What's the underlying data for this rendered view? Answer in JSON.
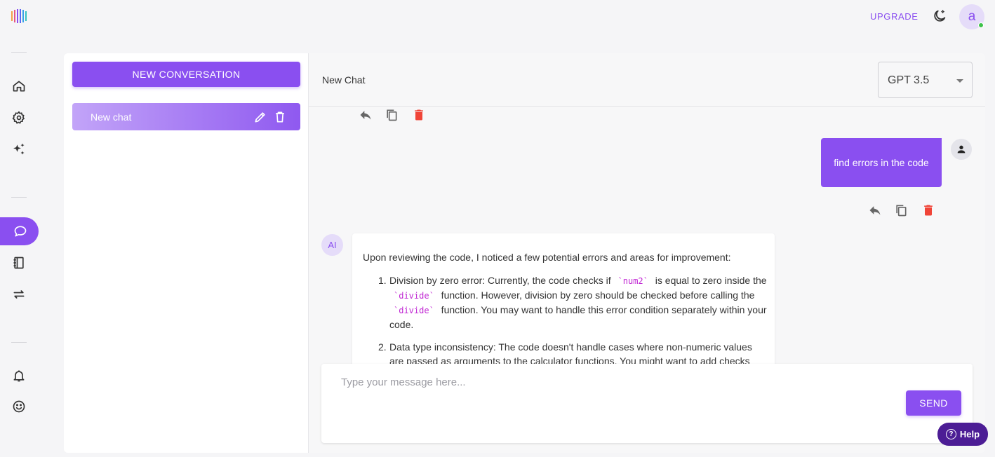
{
  "topbar": {
    "upgrade_label": "UPGRADE",
    "avatar_letter": "a"
  },
  "sidebar": {
    "items": [
      {
        "icon": "home-icon"
      },
      {
        "icon": "gear-icon"
      },
      {
        "icon": "sparkles-icon"
      },
      {
        "icon": "chat-bubble-icon",
        "active": true
      },
      {
        "icon": "notebook-icon"
      },
      {
        "icon": "swap-arrows-icon"
      },
      {
        "icon": "bell-icon"
      },
      {
        "icon": "smiley-icon"
      }
    ]
  },
  "conversations": {
    "new_button_label": "NEW CONVERSATION",
    "items": [
      {
        "title": "New chat"
      }
    ]
  },
  "chat": {
    "title": "New Chat",
    "model": "GPT 3.5",
    "messages": [
      {
        "role": "user",
        "text": "find errors in the code"
      },
      {
        "role": "ai",
        "avatar_label": "AI",
        "intro": "Upon reviewing the code, I noticed a few potential errors and areas for improvement:",
        "points": [
          {
            "num": "1.",
            "p1": "Division by zero error: Currently, the code checks if ",
            "code1": "`num2`",
            "p2": " is equal to zero inside the ",
            "code2": "`divide`",
            "p3": " function. However, division by zero should be checked before calling the ",
            "code3": "`divide`",
            "p4": " function. You may want to handle this error condition separately within your code."
          },
          {
            "num": "2.",
            "text": "Data type inconsistency: The code doesn't handle cases where non-numeric values are passed as arguments to the calculator functions. You might want to add checks"
          }
        ]
      }
    ],
    "composer": {
      "placeholder": "Type your message here...",
      "send_label": "SEND"
    }
  },
  "help": {
    "label": "Help"
  },
  "colors": {
    "accent": "#8a4ff0",
    "danger": "#f04438",
    "help_bg": "#4c1d95"
  }
}
